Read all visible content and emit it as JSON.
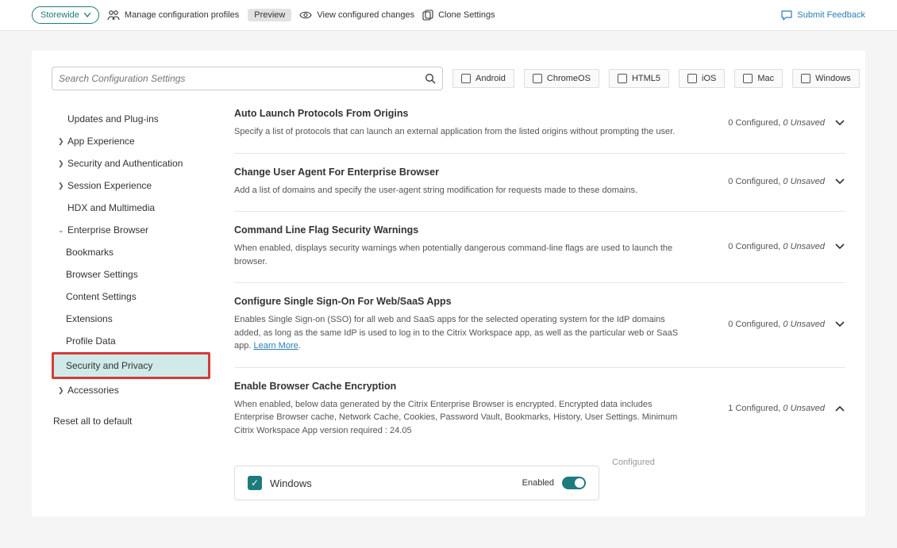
{
  "topbar": {
    "scope": "Storewide",
    "manage": "Manage configuration profiles",
    "preview": "Preview",
    "viewChanges": "View configured changes",
    "clone": "Clone Settings",
    "feedback": "Submit Feedback"
  },
  "search": {
    "placeholder": "Search Configuration Settings"
  },
  "osFilters": [
    "Android",
    "ChromeOS",
    "HTML5",
    "iOS",
    "Mac",
    "Windows"
  ],
  "sidebar": {
    "items": [
      {
        "label": "Updates and Plug-ins",
        "expandable": false
      },
      {
        "label": "App Experience",
        "expandable": true
      },
      {
        "label": "Security and Authentication",
        "expandable": true
      },
      {
        "label": "Session Experience",
        "expandable": true
      },
      {
        "label": "HDX and Multimedia",
        "expandable": true
      },
      {
        "label": "Enterprise Browser",
        "expandable": true,
        "expanded": true
      },
      {
        "label": "Bookmarks",
        "sub": true
      },
      {
        "label": "Browser Settings",
        "sub": true
      },
      {
        "label": "Content Settings",
        "sub": true
      },
      {
        "label": "Extensions",
        "sub": true
      },
      {
        "label": "Profile Data",
        "sub": true
      },
      {
        "label": "Security and Privacy",
        "sub": true,
        "active": true
      },
      {
        "label": "Accessories",
        "expandable": true
      }
    ],
    "reset": "Reset all to default"
  },
  "settings": [
    {
      "title": "Auto Launch Protocols From Origins",
      "desc": "Specify a list of protocols that can launch an external application from the listed origins without prompting the user.",
      "status": {
        "configured": 0,
        "unsaved": 0
      },
      "expanded": false
    },
    {
      "title": "Change User Agent For Enterprise Browser",
      "desc": "Add a list of domains and specify the user-agent string modification for requests made to these domains.",
      "status": {
        "configured": 0,
        "unsaved": 0
      },
      "expanded": false
    },
    {
      "title": "Command Line Flag Security Warnings",
      "desc": "When enabled, displays security warnings when potentially dangerous command-line flags are used to launch the browser.",
      "status": {
        "configured": 0,
        "unsaved": 0
      },
      "expanded": false
    },
    {
      "title": "Configure Single Sign-On For Web/SaaS Apps",
      "desc": "Enables Single Sign-on (SSO) for all web and SaaS apps for the selected operating system for the IdP domains added, as long as the same IdP is used to log in to the Citrix Workspace app, as well as the particular web or SaaS app. ",
      "link": "Learn More",
      "status": {
        "configured": 0,
        "unsaved": 0
      },
      "expanded": false
    },
    {
      "title": "Enable Browser Cache Encryption",
      "desc": "When enabled, below data generated by the Citrix Enterprise Browser is encrypted. Encrypted data includes Enterprise Browser cache, Network Cache, Cookies, Password Vault, Bookmarks, History, User Settings. Minimum Citrix Workspace App version required : 24.05",
      "status": {
        "configured": 1,
        "unsaved": 0
      },
      "expanded": true,
      "config": {
        "os": "Windows",
        "enabledLabel": "Enabled",
        "sideLabel": "Configured"
      }
    }
  ],
  "labels": {
    "configured": "Configured",
    "unsaved": "Unsaved"
  }
}
